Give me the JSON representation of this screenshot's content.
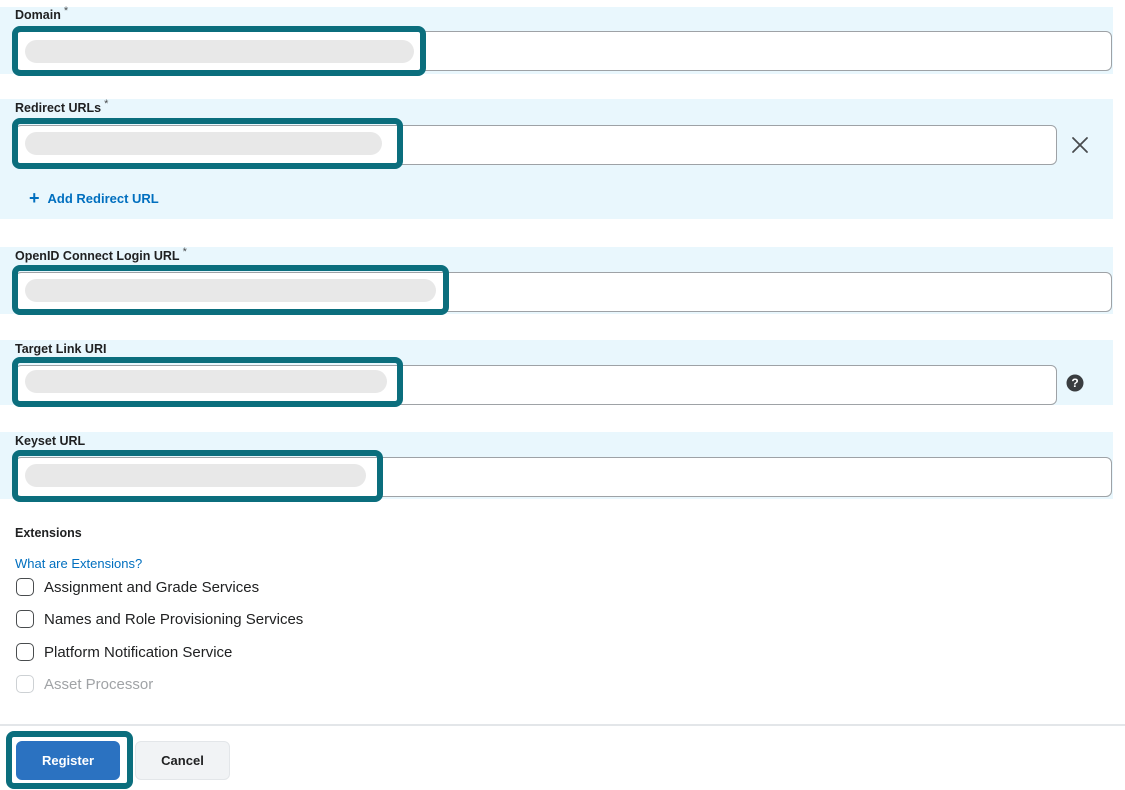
{
  "fields": {
    "domain": {
      "label": "Domain",
      "required_mark": "*",
      "value": ""
    },
    "redirect_urls": {
      "label": "Redirect URLs",
      "required_mark": "*",
      "value": "",
      "add_label": "Add Redirect URL"
    },
    "oidc_login_url": {
      "label": "OpenID Connect Login URL",
      "required_mark": "*",
      "value": ""
    },
    "target_link_uri": {
      "label": "Target Link URI",
      "value": ""
    },
    "keyset_url": {
      "label": "Keyset URL",
      "value": ""
    }
  },
  "extensions": {
    "title": "Extensions",
    "help_link": "What are Extensions?",
    "options": [
      {
        "label": "Assignment and Grade Services",
        "checked": false,
        "disabled": false
      },
      {
        "label": "Names and Role Provisioning Services",
        "checked": false,
        "disabled": false
      },
      {
        "label": "Platform Notification Service",
        "checked": false,
        "disabled": false
      },
      {
        "label": "Asset Processor",
        "checked": false,
        "disabled": true
      }
    ]
  },
  "footer": {
    "register_label": "Register",
    "cancel_label": "Cancel"
  },
  "icons": {
    "remove": "close-icon",
    "help": "help-circle-icon",
    "add": "plus-icon"
  },
  "colors": {
    "highlight": "#0b6e7d",
    "primary": "#2b72c1",
    "band": "#e9f7fd",
    "link": "#006fbf"
  }
}
